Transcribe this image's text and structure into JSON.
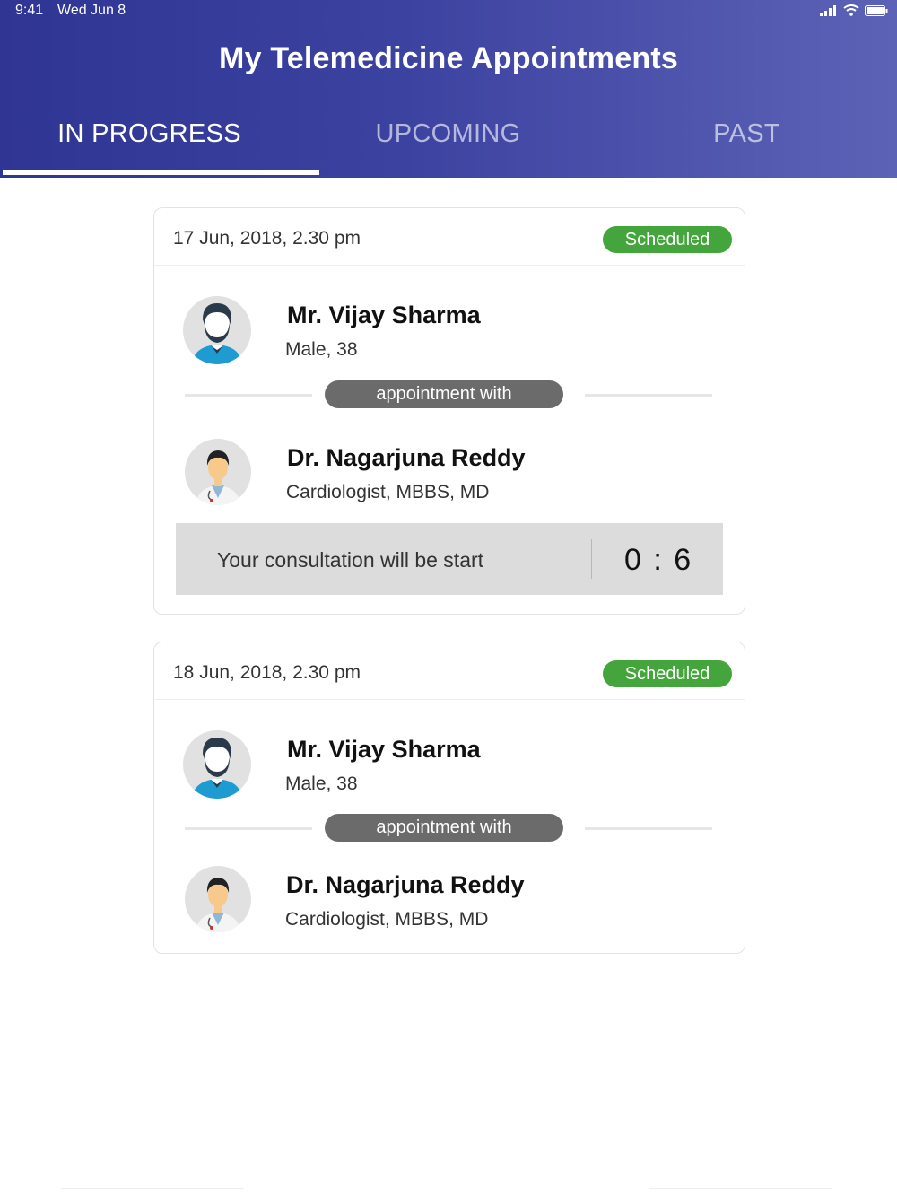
{
  "status_bar": {
    "time": "9:41",
    "date": "Wed Jun 8"
  },
  "header": {
    "title": "My Telemedicine Appointments",
    "tabs": [
      {
        "label": "IN PROGRESS",
        "active": true
      },
      {
        "label": "UPCOMING",
        "active": false
      },
      {
        "label": "PAST",
        "active": false
      }
    ]
  },
  "appointments": [
    {
      "date": "17 Jun, 2018, 2.30 pm",
      "status": "Scheduled",
      "patient": {
        "name": "Mr. Vijay Sharma",
        "details": "Male, 38"
      },
      "connector": "appointment with",
      "doctor": {
        "name": "Dr. Nagarjuna Reddy",
        "details": "Cardiologist, MBBS, MD"
      },
      "consultation": {
        "message": "Your consultation will be start",
        "countdown": "0 : 6"
      }
    },
    {
      "date": "18 Jun, 2018, 2.30 pm",
      "status": "Scheduled",
      "patient": {
        "name": "Mr. Vijay Sharma",
        "details": "Male, 38"
      },
      "connector": "appointment with",
      "doctor": {
        "name": "Dr. Nagarjuna Reddy",
        "details": "Cardiologist, MBBS, MD"
      }
    }
  ],
  "colors": {
    "header_start": "#2f3592",
    "header_end": "#5c63b6",
    "status_scheduled": "#43a53b",
    "pill": "#6b6b6b",
    "consult_bar": "#dcdcdc"
  }
}
